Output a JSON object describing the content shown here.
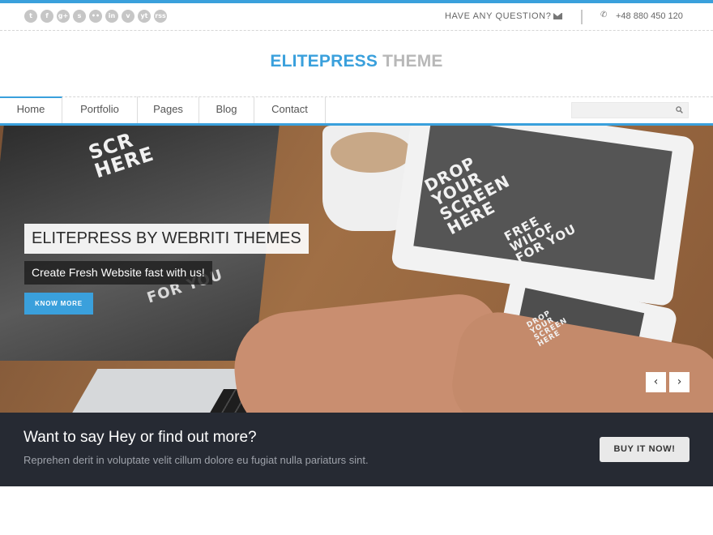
{
  "colors": {
    "accent": "#3aa0dc",
    "cta_background": "#262a33"
  },
  "topbar": {
    "social_icons": [
      "twitter-icon",
      "facebook-icon",
      "google-plus-icon",
      "skype-icon",
      "flickr-icon",
      "linkedin-icon",
      "vimeo-icon",
      "youtube-icon",
      "rss-icon"
    ],
    "social_glyphs": [
      "t",
      "f",
      "g+",
      "s",
      "••",
      "in",
      "v",
      "yt",
      "rss"
    ],
    "question": "HAVE ANY QUESTION?",
    "phone": "+48 880 450 120"
  },
  "brand": {
    "part1": "ELITEPRESS",
    "part2": "THEME"
  },
  "nav": {
    "items": [
      {
        "label": "Home",
        "active": true
      },
      {
        "label": "Portfolio"
      },
      {
        "label": "Pages"
      },
      {
        "label": "Blog"
      },
      {
        "label": "Contact"
      }
    ],
    "search_placeholder": ""
  },
  "slider": {
    "title": "ELITEPRESS BY WEBRITI THEMES",
    "subtitle": "Create Fresh Website fast  with us!",
    "button": "KNOW MORE",
    "prev_glyph": "‹",
    "next_glyph": "›",
    "image_text": {
      "laptop_top": "SCR\nHERE",
      "laptop_mid": "FOR YOU",
      "tablet": "DROP\nYOUR\nSCREEN\nHERE",
      "tablet_bottom": "FREE\nWILOF\nFOR YOU",
      "phone": "DROP\nYOUR\nSCREEN\nHERE"
    }
  },
  "cta": {
    "title": "Want to say Hey or find out more?",
    "text": "Reprehen derit in voluptate velit cillum dolore eu fugiat nulla pariaturs  sint.",
    "button": "BUY IT NOW!"
  }
}
